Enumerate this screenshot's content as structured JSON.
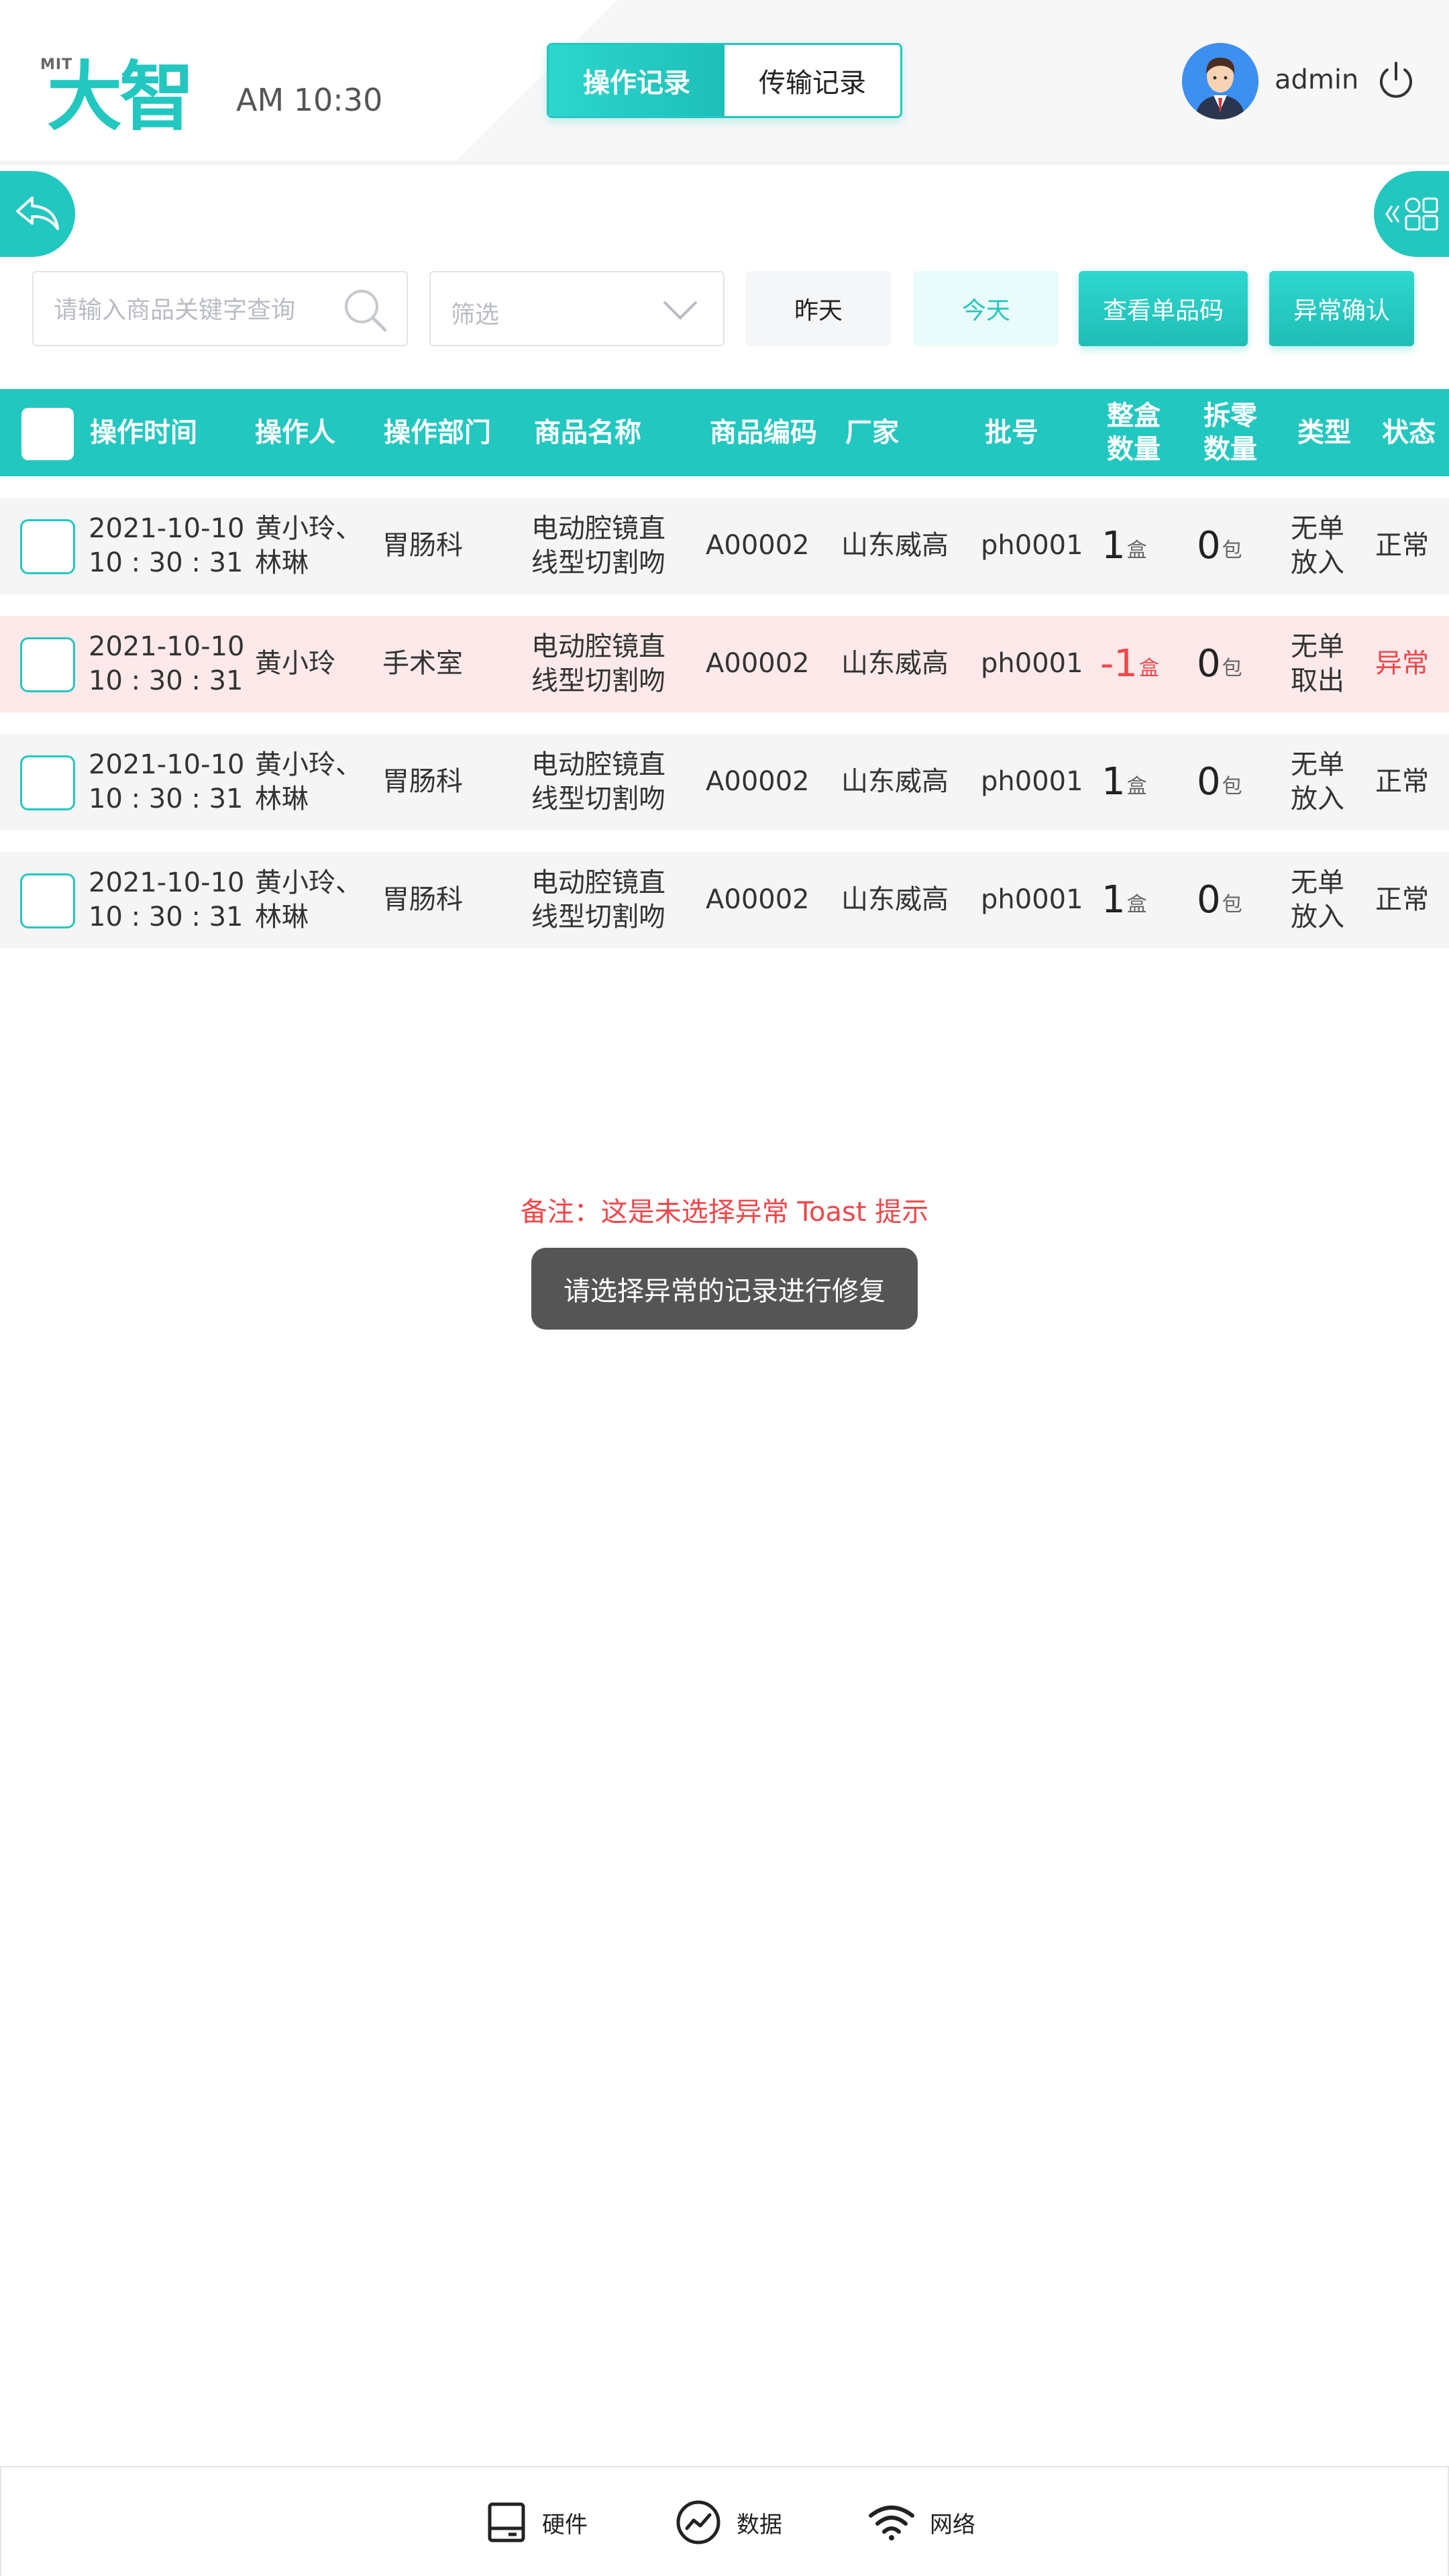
{
  "header": {
    "logo_mit": "MIT",
    "logo_cn": "大智",
    "time": "AM 10:30",
    "tabs": [
      {
        "label": "操作记录",
        "active": true
      },
      {
        "label": "传输记录",
        "active": false
      }
    ],
    "user": "admin",
    "accent_color": "#22c7c0"
  },
  "side": {
    "left_icon": "back-icon",
    "right_icon": "apps-icon"
  },
  "filters": {
    "search_placeholder": "请输入商品关键字查询",
    "select_placeholder": "筛选",
    "yesterday": "昨天",
    "today": "今天",
    "view_code": "查看单品码",
    "confirm_abnormal": "异常确认"
  },
  "table": {
    "headers": {
      "time": "操作时间",
      "operator": "操作人",
      "dept": "操作部门",
      "name": "商品名称",
      "code": "商品编码",
      "maker": "厂家",
      "batch": "批号",
      "box_qty_1": "整盒",
      "box_qty_2": "数量",
      "loose_qty_1": "拆零",
      "loose_qty_2": "数量",
      "type": "类型",
      "status": "状态"
    },
    "rows": [
      {
        "date": "2021-10-10",
        "clock": "10 : 30 : 31",
        "op1": "黄小玲、",
        "op2": "林琳",
        "dept": "胃肠科",
        "name1": "电动腔镜直",
        "name2": "线型切割吻",
        "code": "A00002",
        "maker": "山东威高",
        "batch": "ph0001",
        "box": "1",
        "box_unit": "盒",
        "loose": "0",
        "loose_unit": "包",
        "type1": "无单",
        "type2": "放入",
        "status": "正常"
      },
      {
        "date": "2021-10-10",
        "clock": "10 : 30 : 31",
        "op1": "黄小玲",
        "op2": "",
        "dept": "手术室",
        "name1": "电动腔镜直",
        "name2": "线型切割吻",
        "code": "A00002",
        "maker": "山东威高",
        "batch": "ph0001",
        "box": "-1",
        "box_unit": "盒",
        "loose": "0",
        "loose_unit": "包",
        "type1": "无单",
        "type2": "取出",
        "status": "异常"
      },
      {
        "date": "2021-10-10",
        "clock": "10 : 30 : 31",
        "op1": "黄小玲、",
        "op2": "林琳",
        "dept": "胃肠科",
        "name1": "电动腔镜直",
        "name2": "线型切割吻",
        "code": "A00002",
        "maker": "山东威高",
        "batch": "ph0001",
        "box": "1",
        "box_unit": "盒",
        "loose": "0",
        "loose_unit": "包",
        "type1": "无单",
        "type2": "放入",
        "status": "正常"
      },
      {
        "date": "2021-10-10",
        "clock": "10 : 30 : 31",
        "op1": "黄小玲、",
        "op2": "林琳",
        "dept": "胃肠科",
        "name1": "电动腔镜直",
        "name2": "线型切割吻",
        "code": "A00002",
        "maker": "山东威高",
        "batch": "ph0001",
        "box": "1",
        "box_unit": "盒",
        "loose": "0",
        "loose_unit": "包",
        "type1": "无单",
        "type2": "放入",
        "status": "正常"
      }
    ]
  },
  "toast": {
    "note": "备注：这是未选择异常 Toast 提示",
    "message": "请选择异常的记录进行修复"
  },
  "bottom_nav": {
    "hardware": "硬件",
    "data": "数据",
    "network": "网络"
  }
}
